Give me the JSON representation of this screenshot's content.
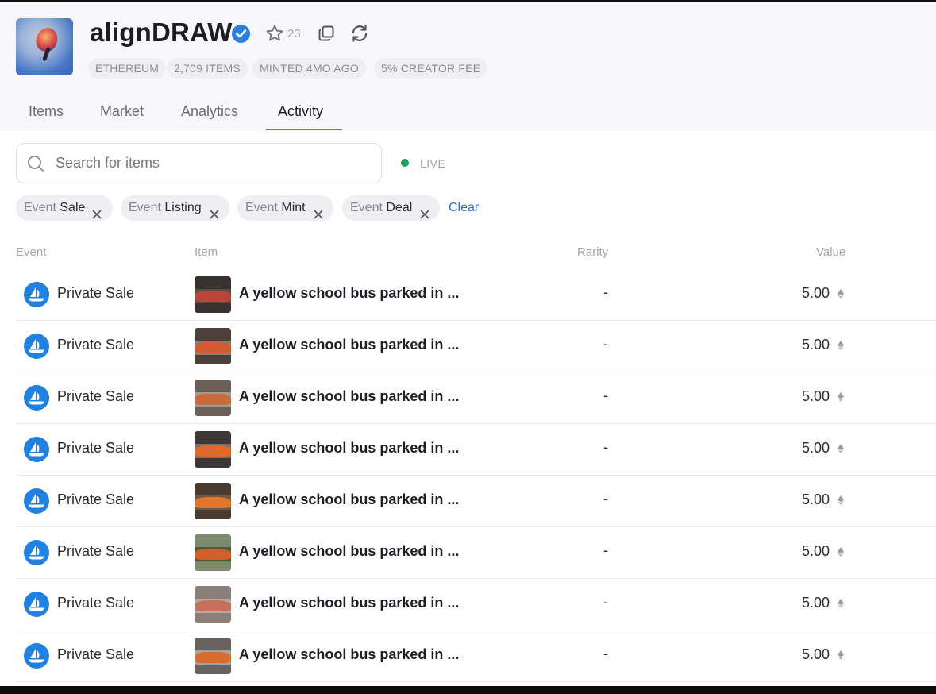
{
  "collection": {
    "title": "alignDRAW",
    "star_count": "23",
    "tags": [
      "ETHEREUM",
      "2,709 ITEMS",
      "MINTED 4MO AGO",
      "5% CREATOR FEE"
    ]
  },
  "tabs": [
    "Items",
    "Market",
    "Analytics",
    "Activity"
  ],
  "active_tab": "Activity",
  "search": {
    "placeholder": "Search for items",
    "value": ""
  },
  "live_label": "LIVE",
  "filters": [
    {
      "key": "Event",
      "value": "Sale"
    },
    {
      "key": "Event",
      "value": "Listing"
    },
    {
      "key": "Event",
      "value": "Mint"
    },
    {
      "key": "Event",
      "value": "Deal"
    }
  ],
  "clear_label": "Clear",
  "table": {
    "columns": [
      "Event",
      "Item",
      "Rarity",
      "Value"
    ],
    "rows": [
      {
        "event": "Private Sale",
        "item": "A yellow school bus parked in ...",
        "rarity": "-",
        "value": "5.00"
      },
      {
        "event": "Private Sale",
        "item": "A yellow school bus parked in ...",
        "rarity": "-",
        "value": "5.00"
      },
      {
        "event": "Private Sale",
        "item": "A yellow school bus parked in ...",
        "rarity": "-",
        "value": "5.00"
      },
      {
        "event": "Private Sale",
        "item": "A yellow school bus parked in ...",
        "rarity": "-",
        "value": "5.00"
      },
      {
        "event": "Private Sale",
        "item": "A yellow school bus parked in ...",
        "rarity": "-",
        "value": "5.00"
      },
      {
        "event": "Private Sale",
        "item": "A yellow school bus parked in ...",
        "rarity": "-",
        "value": "5.00"
      },
      {
        "event": "Private Sale",
        "item": "A yellow school bus parked in ...",
        "rarity": "-",
        "value": "5.00"
      },
      {
        "event": "Private Sale",
        "item": "A yellow school bus parked in ...",
        "rarity": "-",
        "value": "5.00"
      }
    ]
  },
  "colors": {
    "accent_tab_underline": "#8a5ad8",
    "verified_badge": "#2a7fe0",
    "marketplace_icon": "#2081e2",
    "live_dot": "#1aa35a",
    "clear_link": "#2a6fd6"
  },
  "icons": {
    "verified": "verified-check-icon",
    "star": "star-icon",
    "copy": "copy-icon",
    "refresh": "refresh-icon",
    "search": "search-icon",
    "filter_remove": "close-icon",
    "marketplace": "opensea-icon",
    "currency": "ethereum-icon"
  }
}
